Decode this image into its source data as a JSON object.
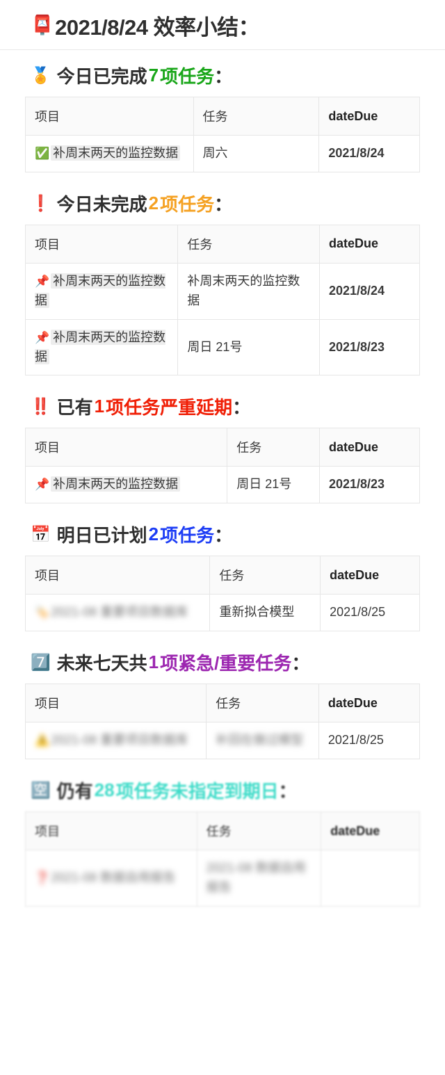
{
  "title": {
    "emoji": "📮",
    "text": "2021/8/24 效率小结："
  },
  "columns": {
    "project": "项目",
    "task": "任务",
    "due": "dateDue"
  },
  "colors": {
    "done_green": "#19a619",
    "undone_orange": "#f5a122",
    "overdue_red": "#f01f06",
    "planned_blue": "#1d3df5",
    "urgent_purple": "#9c26b0",
    "nodate_teal": "#3ddbc8",
    "due_red": "#f01f06"
  },
  "sections": [
    {
      "id": "done-today",
      "emoji": "🏅",
      "pre": "今日已完成",
      "count": "7",
      "post": "项任务",
      "colon": "：",
      "highlight": "#19a619",
      "highlight_post": false,
      "rows": [
        {
          "emoji": "✅",
          "project": "补周末两天的监控数据",
          "chip": true,
          "task": "周六",
          "due": "2021/8/24",
          "due_style": "red",
          "redacted": false
        }
      ]
    },
    {
      "id": "undone-today",
      "emoji": "❗",
      "pre": "今日未完成",
      "count": "2",
      "post": "项任务",
      "colon": "：",
      "highlight": "#f5a122",
      "highlight_post": false,
      "rows": [
        {
          "emoji": "📌",
          "project": "补周末两天的监控数据",
          "chip": true,
          "task": "补周末两天的监控数据",
          "due": "2021/8/24",
          "due_style": "red",
          "redacted": false
        },
        {
          "emoji": "📌",
          "project": "补周末两天的监控数据",
          "chip": true,
          "task": "周日 21号",
          "due": "2021/8/23",
          "due_style": "red",
          "redacted": false
        }
      ]
    },
    {
      "id": "severely-overdue",
      "emoji": "‼️",
      "pre": "已有",
      "count": "1",
      "post": "项任务严重延期",
      "colon": "：",
      "highlight": "#f01f06",
      "highlight_post": true,
      "rows": [
        {
          "emoji": "📌",
          "project": "补周末两天的监控数据",
          "chip": true,
          "task": "周日 21号",
          "due": "2021/8/23",
          "due_style": "red",
          "redacted": false
        }
      ]
    },
    {
      "id": "planned-tomorrow",
      "emoji": "📅",
      "pre": "明日已计划",
      "count": "2",
      "post": "项任务",
      "colon": "：",
      "highlight": "#1d3df5",
      "highlight_post": false,
      "rows": [
        {
          "emoji": "🏷️",
          "project": "2021-08 重要项目数据库",
          "chip": false,
          "task": "重新拟合模型",
          "due": "2021/8/25",
          "due_style": "plain",
          "redacted": true,
          "task_redacted": false
        }
      ]
    },
    {
      "id": "next-seven-days",
      "emoji": "7️⃣",
      "pre": "未来七天共",
      "count": "1",
      "post": "项紧急/重要任务",
      "colon": "：",
      "highlight": "#9c26b0",
      "highlight_post": true,
      "rows": [
        {
          "emoji": "⚠️",
          "project": "2021-08 重要项目数据库",
          "chip": false,
          "task": "补回在做过模型",
          "due": "2021/8/25",
          "due_style": "plain",
          "redacted": true,
          "task_redacted": true
        }
      ]
    },
    {
      "id": "no-due-date",
      "emoji": "🈳",
      "pre": "仍有",
      "count": "28",
      "post": "项任务未指定到期日",
      "colon": "：",
      "highlight": "#3ddbc8",
      "highlight_post": true,
      "blurred_section": true,
      "rows": [
        {
          "emoji": "❓",
          "project": "2021-08 数据自用报告",
          "chip": false,
          "task": "2021-08 数据自用报告",
          "due": "",
          "due_style": "plain",
          "redacted": true,
          "task_redacted": true
        }
      ]
    }
  ]
}
